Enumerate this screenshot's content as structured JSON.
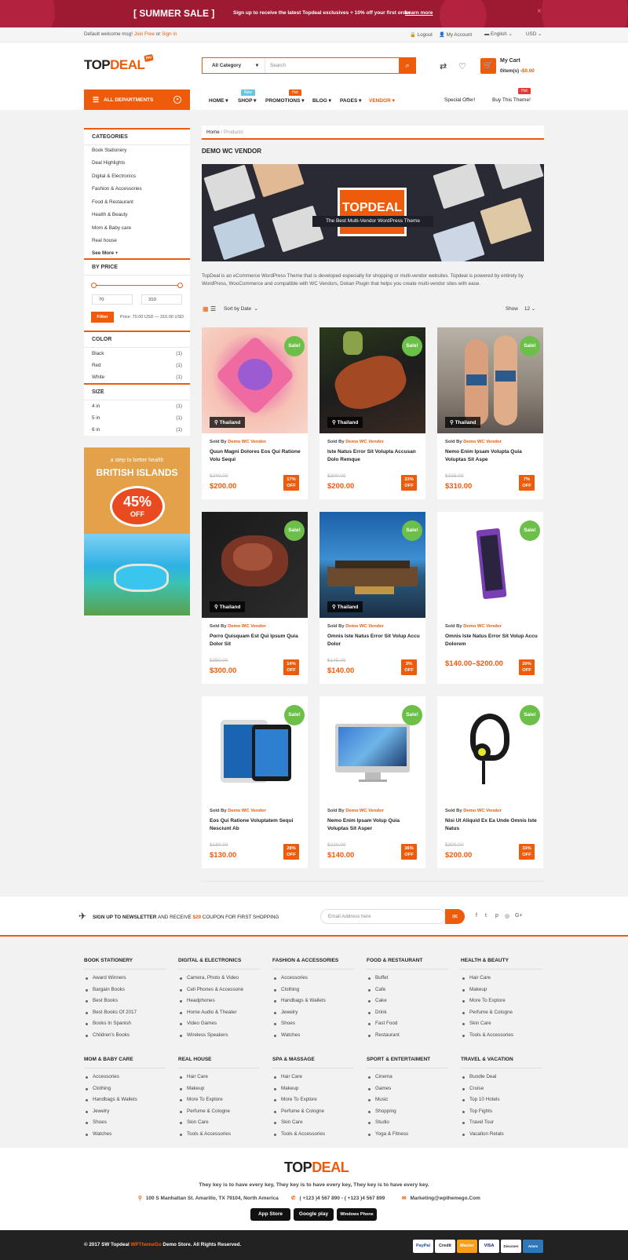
{
  "banner": {
    "title": "[ SUMMER SALE ]",
    "text": "Sign up to receive the latest Topdeal exclusives + 10% off your first order",
    "link": "Learn more",
    "close": "×"
  },
  "topbar": {
    "welcome": "Default welcome msg!",
    "join": "Join Free",
    "or": "or",
    "signin": "Sign in",
    "logout": "Logout",
    "account": "My Account",
    "lang": "English",
    "currency": "USD"
  },
  "header": {
    "logo_a": "TOP",
    "logo_b": "DEAL",
    "logo_badge": "Pro",
    "category": "All Category",
    "search_placeholder": "Search",
    "cart_title": "My Cart",
    "cart_items": "0item(s) -",
    "cart_total": "$0.00"
  },
  "nav": {
    "departments": "ALL DEPARTMENTS",
    "items": [
      "HOME",
      "SHOP",
      "PROMOTIONS",
      "BLOG",
      "PAGES",
      "VENDOR"
    ],
    "badge_new": "New",
    "badge_hot": "Hot",
    "special": "Special Offer!",
    "buy": "Buy This Theme!",
    "buy_badge": "Hot"
  },
  "sidebar": {
    "categories_title": "CATEGORIES",
    "categories": [
      "Book Stationery",
      "Deal Highlights",
      "Digital & Electronics",
      "Fashion & Accessories",
      "Food & Restaurant",
      "Health & Beauty",
      "Mom & Baby care",
      "Real house",
      "See More +"
    ],
    "price_title": "BY PRICE",
    "price_min": "70",
    "price_max": "310",
    "filter": "Filter",
    "price_text": "Price: 70.00 USD — 310.00 USD",
    "color_title": "COLOR",
    "colors": [
      {
        "name": "Black",
        "count": "(1)"
      },
      {
        "name": "Red",
        "count": "(1)"
      },
      {
        "name": "White",
        "count": "(1)"
      }
    ],
    "size_title": "SIZE",
    "sizes": [
      {
        "name": "4 in",
        "count": "(1)"
      },
      {
        "name": "5 in",
        "count": "(1)"
      },
      {
        "name": "6 in",
        "count": "(1)"
      }
    ]
  },
  "promo": {
    "line1": "a step to better health",
    "line2": "BRITISH ISLANDS",
    "percent": "45%",
    "off": "OFF"
  },
  "breadcrumb": {
    "home": "Home",
    "sep": "/",
    "current": "Products"
  },
  "page_title": "DEMO WC VENDOR",
  "hero": {
    "logo": "TOPDEAL",
    "tag": "The Best Multi-Vendor WordPress Theme"
  },
  "description": "TopDeal is an eCommerce WordPress Theme that is developed especially for shopping or multi-vendor websites. Topdeal is powered by entirely by WordPress, WooCommerce and compatible with WC Vendors, Dokan Plugin that helps you create multi-vendor sites with ease.",
  "toolbar": {
    "sort": "Sort by Date",
    "show": "Show",
    "per_page": "12"
  },
  "products": [
    {
      "name": "Quun Magni Dolores Eos Qui Ratione Volu Sequi",
      "old": "$240.00",
      "price": "$200.00",
      "off1": "17%",
      "location": "Thailand"
    },
    {
      "name": "Iste Natus Error Sit Volupta Accusan Dolo Remque",
      "old": "$300.00",
      "price": "$200.00",
      "off1": "33%",
      "location": "Thailand"
    },
    {
      "name": "Nemo Enim Ipsam Volupta Quia Voluptas Sit Aspe",
      "old": "$335.00",
      "price": "$310.00",
      "off1": "7%",
      "location": "Thailand"
    },
    {
      "name": "Porro Quisquam Est Qui Ipsum Quia Dolor Sit",
      "old": "$350.00",
      "price": "$300.00",
      "off1": "14%",
      "location": "Thailand"
    },
    {
      "name": "Omnis Iste Natus Error Sit Volup Accu Dolor",
      "old": "$145.00",
      "price": "$140.00",
      "off1": "3%",
      "location": "Thailand"
    },
    {
      "name": "Omnis Iste Natus Error Sit Volup Accu Dolorem",
      "old": "",
      "price": "$140.00–$200.00",
      "off1": "20%",
      "location": ""
    },
    {
      "name": "Eos Qui Ratione Voluptatem Sequi Nesciunt Ab",
      "old": "$180.00",
      "price": "$130.00",
      "off1": "28%",
      "location": ""
    },
    {
      "name": "Nemo Enim Ipsam Volup Quia Voluptas Sit Asper",
      "old": "$220.00",
      "price": "$140.00",
      "off1": "36%",
      "location": ""
    },
    {
      "name": "Nisi Ut Aliquid Ex Ea Unde Omnis Iste Natus",
      "old": "$300.00",
      "price": "$200.00",
      "off1": "33%",
      "location": ""
    }
  ],
  "product_labels": {
    "sale": "Sale!",
    "sold_by": "Sold By",
    "vendor": "Demo WC Vendor",
    "off": "OFF"
  },
  "newsletter": {
    "a": "SIGN UP TO NEWSLETTER",
    "b": "AND RECEIVE",
    "c": "$29",
    "d": "COUPON FOR FIRST SHOPPING",
    "placeholder": "Email Address here"
  },
  "footer_cols": [
    {
      "title": "BOOK STATIONERY",
      "items": [
        "Award Winners",
        "Bargain Books",
        "Best Books",
        "Best Books Of 2017",
        "Books In Spanish",
        "Children's Books"
      ]
    },
    {
      "title": "DIGITAL & ELECTRONICS",
      "items": [
        "Camera, Photo & Video",
        "Cell Phones & Accessorie",
        "Headphones",
        "Home Audio & Theater",
        "Video Games",
        "Wireless Speakers"
      ]
    },
    {
      "title": "FASHION & ACCESSORIES",
      "items": [
        "Accessories",
        "Clothing",
        "Handbags & Wallets",
        "Jewelry",
        "Shoes",
        "Watches"
      ]
    },
    {
      "title": "FOOD & RESTAURANT",
      "items": [
        "Buffet",
        "Cafe",
        "Cake",
        "Drink",
        "Fast Food",
        "Restaurant"
      ]
    },
    {
      "title": "HEALTH & BEAUTY",
      "items": [
        "Hair Care",
        "Makeup",
        "More To Explore",
        "Perfume & Cologne",
        "Skin Care",
        "Tools & Accessories"
      ]
    },
    {
      "title": "MOM & BABY CARE",
      "items": [
        "Accessories",
        "Clothing",
        "Handbags & Wallets",
        "Jewelry",
        "Shoes",
        "Watches"
      ]
    },
    {
      "title": "REAL HOUSE",
      "items": [
        "Hair Care",
        "Makeup",
        "More To Explore",
        "Perfume & Cologne",
        "Skin Care",
        "Tools & Accessories"
      ]
    },
    {
      "title": "SPA & MASSAGE",
      "items": [
        "Hair Care",
        "Makeup",
        "More To Explore",
        "Perfume & Cologne",
        "Skin Care",
        "Tools & Accessories"
      ]
    },
    {
      "title": "SPORT & ENTERTAIMENT",
      "items": [
        "Cinema",
        "Games",
        "Music",
        "Shopping",
        "Studio",
        "Yoga & Fitness"
      ]
    },
    {
      "title": "TRAVEL & VACATION",
      "items": [
        "Bundle Deal",
        "Cruise",
        "Top 10 Hotels",
        "Top Fights",
        "Travel Tour",
        "Vacation Retals"
      ]
    }
  ],
  "footer": {
    "tagline": "They key is to have every key, They key is to have every key, They key is to have every key.",
    "address": "100 S Manhattan St. Amarillo, TX 79104, North America",
    "phone": "( +123 )4 567 890 - ( +123 )4 567 899",
    "email": "Marketing@wpthemego.Com",
    "stores": [
      "App Store",
      "Google play",
      "Windows Phone"
    ]
  },
  "copyright": {
    "a": "© 2017 SW Topdeal",
    "b": "WPThemeGo",
    "c": "Demo Store. All Rights Reserved."
  },
  "payments": [
    "PayPal",
    "Credit",
    "Master",
    "VISA",
    "Discover",
    "Amex"
  ],
  "colors": {
    "accent": "#ee5b0b",
    "sale": "#6cc04a",
    "banner": "#9e1a33"
  }
}
